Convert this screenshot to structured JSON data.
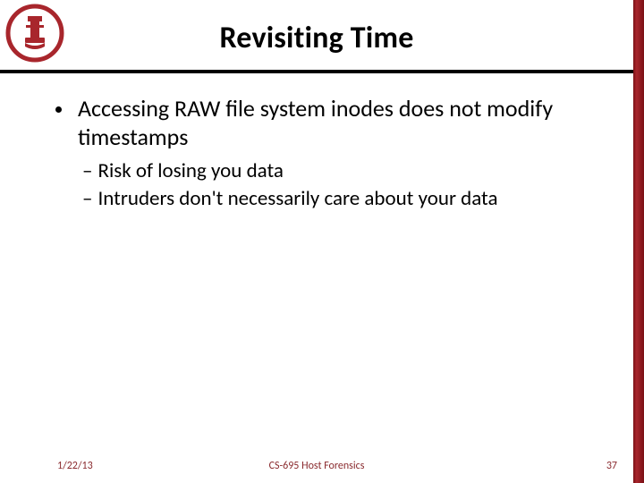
{
  "title": "Revisiting Time",
  "bullet": "Accessing RAW file system inodes does not modify timestamps",
  "subbullets": [
    "Risk of losing you data",
    "Intruders don't necessarily care about your data"
  ],
  "footer": {
    "date": "1/22/13",
    "center": "CS-695 Host Forensics",
    "page": "37"
  },
  "colors": {
    "accent": "#8a2a2e"
  }
}
